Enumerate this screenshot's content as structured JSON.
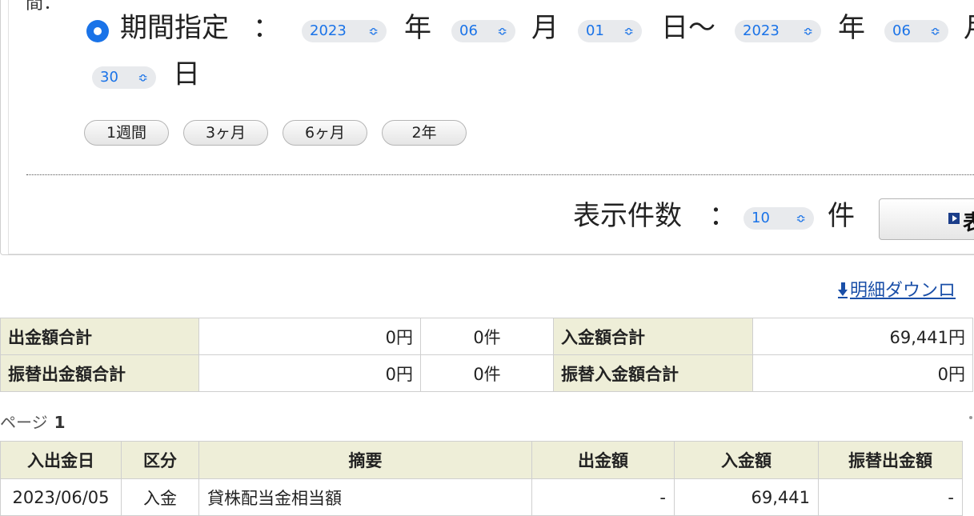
{
  "period": {
    "cut_label": "間：",
    "radio_label": "期間指定",
    "colon": "：",
    "from": {
      "year": "2023",
      "month": "06",
      "day": "01"
    },
    "to": {
      "year": "2023",
      "month": "06",
      "day": "30"
    },
    "year_unit": "年",
    "month_unit": "月",
    "day_unit_tilde": "日〜",
    "day_unit": "日",
    "month_unit_cut": "月",
    "quick_buttons": [
      "1週間",
      "3ヶ月",
      "6ヶ月",
      "2年"
    ]
  },
  "display": {
    "label": "表示件数",
    "colon": "：",
    "count": "10",
    "unit": "件",
    "button_label": "表"
  },
  "download_link": "明細ダウンロ",
  "summary": {
    "rows": [
      {
        "h1": "出金額合計",
        "v1": "0円",
        "c1": "0件",
        "h2": "入金額合計",
        "v2": "69,441円"
      },
      {
        "h1": "振替出金額合計",
        "v1": "0円",
        "c1": "0件",
        "h2": "振替入金額合計",
        "v2": "0円"
      }
    ]
  },
  "page": {
    "label": "ページ",
    "number": "1"
  },
  "details": {
    "headers": [
      "入出金日",
      "区分",
      "摘要",
      "出金額",
      "入金額",
      "振替出金額"
    ],
    "rows": [
      [
        "2023/06/05",
        "入金",
        "貸株配当金相当額",
        "-",
        "69,441",
        "-"
      ]
    ]
  },
  "colors": {
    "accent": "#1a73e8",
    "header_bg": "#eeeed8",
    "link": "#1a4fa8"
  }
}
